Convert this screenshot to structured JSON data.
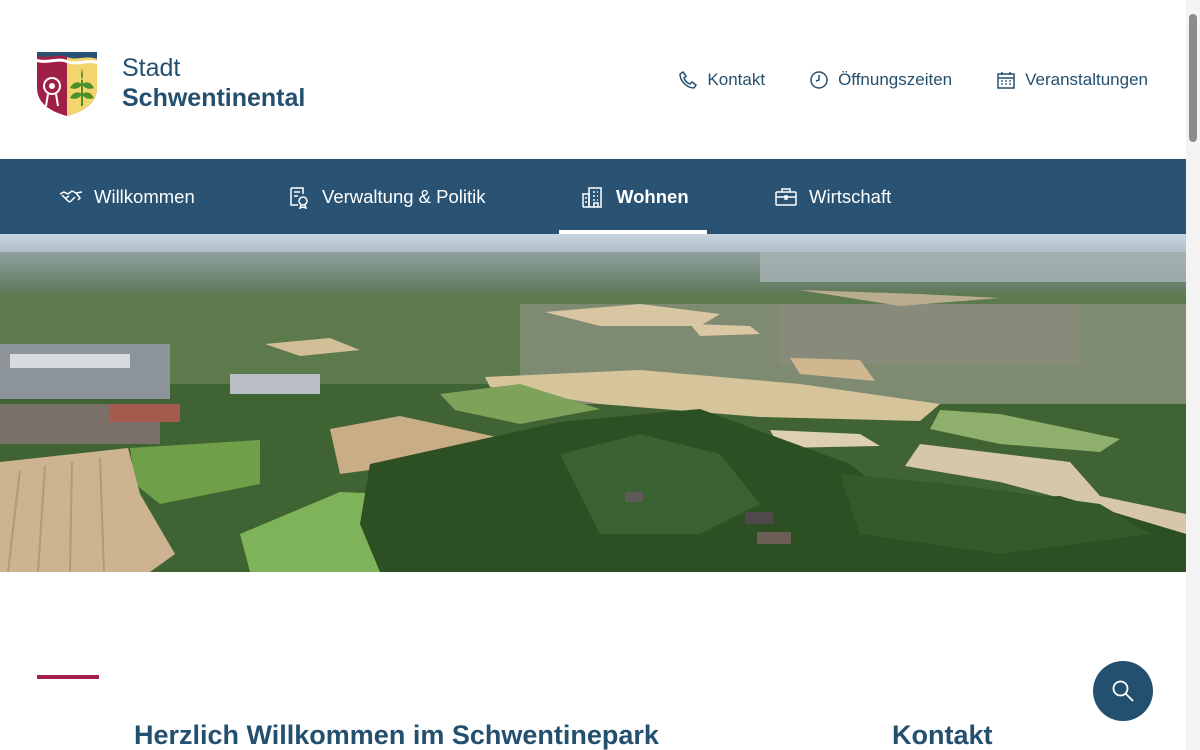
{
  "site": {
    "name_line1": "Stadt",
    "name_line2": "Schwentinental"
  },
  "service_nav": [
    {
      "label": "Kontakt",
      "icon": "phone-icon"
    },
    {
      "label": "Öffnungszeiten",
      "icon": "clock-icon"
    },
    {
      "label": "Veranstaltungen",
      "icon": "calendar-icon"
    }
  ],
  "main_nav": [
    {
      "label": "Willkommen",
      "icon": "handshake-icon",
      "active": false
    },
    {
      "label": "Verwaltung & Politik",
      "icon": "administration-icon",
      "active": false
    },
    {
      "label": "Wohnen",
      "icon": "buildings-icon",
      "active": true
    },
    {
      "label": "Wirtschaft",
      "icon": "briefcase-icon",
      "active": false
    }
  ],
  "hero": {
    "alt": "Luftaufnahme Schwentinental"
  },
  "content": {
    "title": "Herzlich Willkommen im Schwentinepark",
    "aside_title": "Kontakt"
  },
  "colors": {
    "brand_blue": "#2a5273",
    "text_blue": "#24506f",
    "accent_red": "#a3224a"
  }
}
